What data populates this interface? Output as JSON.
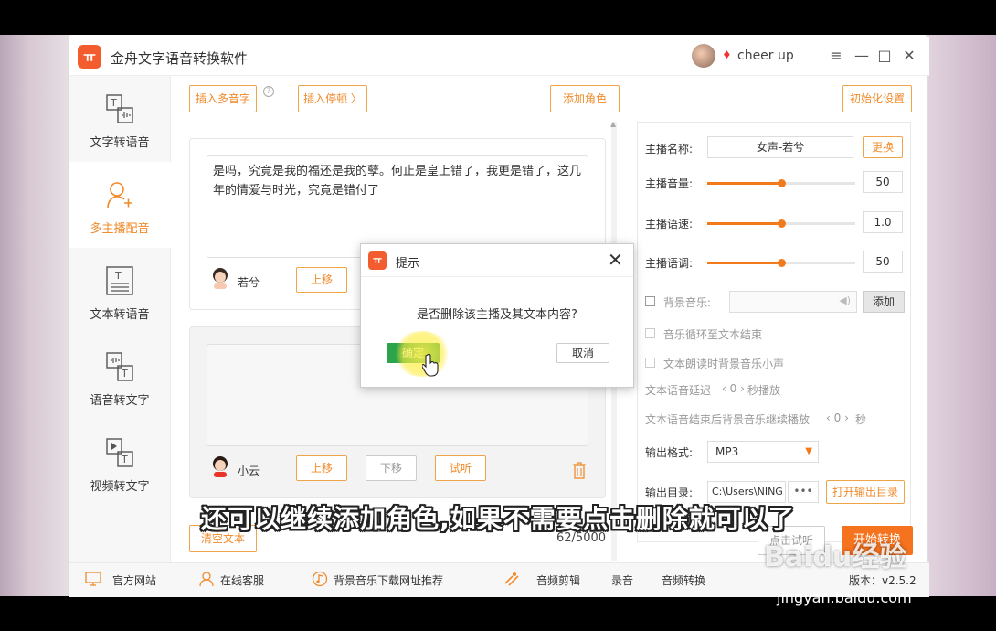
{
  "app": {
    "title": "金舟文字语音转换软件",
    "logo_text": "ㅠ",
    "username": "cheer up",
    "controls": [
      "≡",
      "—",
      "□",
      "✕"
    ]
  },
  "sidebar": {
    "items": [
      {
        "label": "文字转语音",
        "icon": "text-to-speech-icon"
      },
      {
        "label": "多主播配音",
        "icon": "add-user-icon",
        "active": true
      },
      {
        "label": "文本转语音",
        "icon": "document-icon"
      },
      {
        "label": "语音转文字",
        "icon": "speech-to-text-icon"
      },
      {
        "label": "视频转文字",
        "icon": "video-to-text-icon"
      }
    ]
  },
  "toolbar": {
    "insert_polyphone": "插入多音字",
    "insert_pause": "插入停顿 〉",
    "add_role": "添加角色",
    "init_settings": "初始化设置",
    "help": "?"
  },
  "cards": [
    {
      "text": "是吗，究竟是我的福还是我的孽。何止是皇上错了，我更是错了，这几年的情爱与时光，究竟是错付了",
      "name": "若兮",
      "up": "上移"
    },
    {
      "text": "",
      "name": "小云",
      "up": "上移",
      "down": "下移",
      "listen": "试听"
    }
  ],
  "settings": {
    "anchor_label": "主播名称:",
    "anchor_value": "女声-若兮",
    "change": "更换",
    "volume_label": "主播音量:",
    "volume": "50",
    "volume_level": 0.5,
    "speed_label": "主播语速:",
    "speed": "1.0",
    "speed_level": 0.5,
    "pitch_label": "主播语调:",
    "pitch": "50",
    "pitch_level": 0.5,
    "bgm_label": "背景音乐:",
    "add": "添加",
    "loop_label": "音乐循环至文本结束",
    "duck_label": "文本朗读时背景音乐小声",
    "delay_text": "文本语音延迟",
    "delay_value": "‹ 0 ›",
    "delay_unit": "秒播放",
    "after_text": "文本语音结束后背景音乐继续播放",
    "after_value": "‹ 0 ›",
    "after_unit": "秒",
    "format_label": "输出格式:",
    "format_value": "MP3",
    "dir_label": "输出目录:",
    "dir_value": "C:\\Users\\NING",
    "dots": "•••",
    "open_dir": "打开输出目录"
  },
  "footer_actions": {
    "clear": "清空文本",
    "counter": "62/5000",
    "listen": "点击试听",
    "start": "开始转换"
  },
  "bottombar": {
    "items": [
      "官方网站",
      "在线客服",
      "背景音乐下载网址推荐",
      "音频剪辑",
      "录音",
      "音频转换"
    ],
    "version": "版本：v2.5.2"
  },
  "dialog": {
    "title": "提示",
    "message": "是否删除该主播及其文本内容?",
    "ok": "确定",
    "cancel": "取消",
    "close": "✕"
  },
  "subtitle": "还可以继续添加角色,如果不需要点击删除就可以了",
  "watermark": "Baidu经验",
  "watermark_url": "jingyan.baidu.com"
}
